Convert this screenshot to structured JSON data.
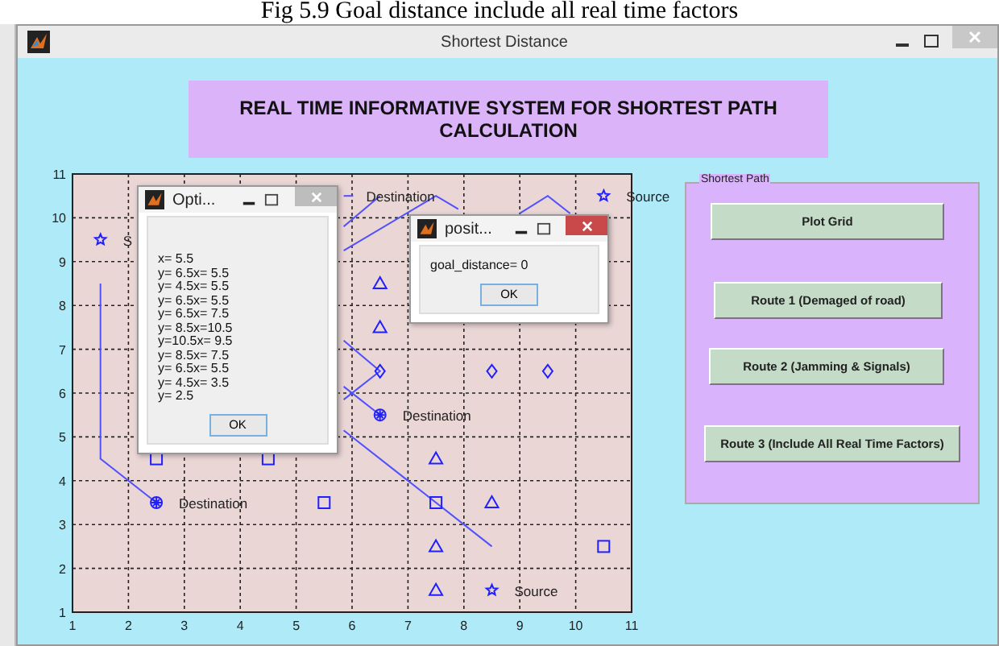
{
  "caption": "Fig 5.9 Goal distance include all real time factors",
  "window": {
    "title": "Shortest Distance"
  },
  "header": "REAL TIME INFORMATIVE SYSTEM FOR SHORTEST PATH CALCULATION",
  "plot": {
    "chart_data": {
      "type": "scatter",
      "grid": true,
      "xlim": [
        1,
        11
      ],
      "ylim": [
        1,
        11
      ],
      "xticks": [
        1,
        2,
        3,
        4,
        5,
        6,
        7,
        8,
        9,
        10,
        11
      ],
      "yticks": [
        1,
        2,
        3,
        4,
        5,
        6,
        7,
        8,
        9,
        10,
        11
      ],
      "series": [
        {
          "type": "line",
          "color": "#5050ff",
          "x": [
            1.5,
            1.5,
            2.5
          ],
          "values": [
            8.5,
            4.5,
            3.5
          ]
        },
        {
          "type": "line",
          "color": "#5050ff",
          "x": [
            5.85,
            7.5,
            7.9
          ],
          "values": [
            9.25,
            10.5,
            10.2
          ]
        },
        {
          "type": "line",
          "color": "#5050ff",
          "x": [
            5.85,
            6.5
          ],
          "values": [
            9.8,
            10.5
          ]
        },
        {
          "type": "line",
          "color": "#5050ff",
          "x": [
            5.85,
            6.02
          ],
          "values": [
            10.5,
            10.5
          ]
        },
        {
          "type": "line",
          "color": "#5050ff",
          "x": [
            9,
            9.5,
            9.9
          ],
          "values": [
            10.1,
            10.5,
            10.1
          ]
        },
        {
          "type": "line",
          "color": "#5050ff",
          "x": [
            5.85,
            6.5,
            5.85
          ],
          "values": [
            7.2,
            6.5,
            5.85
          ]
        },
        {
          "type": "line",
          "color": "#5050ff",
          "x": [
            5.85,
            6.5
          ],
          "values": [
            6.15,
            5.5
          ]
        },
        {
          "type": "line",
          "color": "#5050ff",
          "x": [
            5.85,
            8.5
          ],
          "values": [
            5.15,
            2.5
          ]
        },
        {
          "marker": "star",
          "color": "#2020ff",
          "x": [
            1.5,
            10.5,
            8.5
          ],
          "values": [
            9.5,
            10.5,
            1.5
          ]
        },
        {
          "marker": "circle-asterisk",
          "color": "#2020ff",
          "x": [
            2.5,
            6.5
          ],
          "values": [
            3.5,
            5.5
          ]
        },
        {
          "marker": "triangle",
          "color": "#2020ff",
          "x": [
            6.5,
            6.5,
            7.5,
            8.5,
            7.5,
            7.5
          ],
          "values": [
            8.5,
            7.5,
            4.5,
            3.5,
            2.5,
            1.5
          ]
        },
        {
          "marker": "diamond",
          "color": "#2020ff",
          "x": [
            6.5,
            8.5,
            9.5
          ],
          "values": [
            6.5,
            6.5,
            6.5
          ]
        },
        {
          "marker": "square",
          "color": "#2020ff",
          "x": [
            2.5,
            4.5,
            5.5,
            7.5,
            10.5
          ],
          "values": [
            4.5,
            4.5,
            3.5,
            3.5,
            2.5
          ]
        }
      ],
      "annotations": [
        {
          "text": "S",
          "x": 1.5,
          "y": 9.5
        },
        {
          "text": "Destination",
          "x": 5.85,
          "y": 10.5
        },
        {
          "text": "Source",
          "x": 10.5,
          "y": 10.5
        },
        {
          "text": "Destination",
          "x": 6.5,
          "y": 5.5
        },
        {
          "text": "Destination",
          "x": 2.5,
          "y": 3.5
        },
        {
          "text": "Source",
          "x": 8.5,
          "y": 1.5
        }
      ]
    }
  },
  "panel": {
    "title": "Shortest Path",
    "buttons": [
      {
        "label": "Plot Grid"
      },
      {
        "label": "Route 1 (Demaged of road)"
      },
      {
        "label": "Route 2 (Jamming & Signals)"
      },
      {
        "label": "Route 3 (Include All Real Time Factors)"
      }
    ]
  },
  "dialogs": [
    {
      "title": "Opti...",
      "active": false,
      "lines": [
        "x= 5.5",
        "y= 6.5x= 5.5",
        "y= 4.5x= 5.5",
        "y= 6.5x= 5.5",
        "y= 6.5x= 7.5",
        "y= 8.5x=10.5",
        "y=10.5x= 9.5",
        "y= 8.5x= 7.5",
        "y= 6.5x= 5.5",
        "y= 4.5x= 3.5",
        "y= 2.5"
      ],
      "button": "OK"
    },
    {
      "title": "posit...",
      "active": true,
      "lines": [
        "goal_distance= 0"
      ],
      "button": "OK"
    }
  ]
}
